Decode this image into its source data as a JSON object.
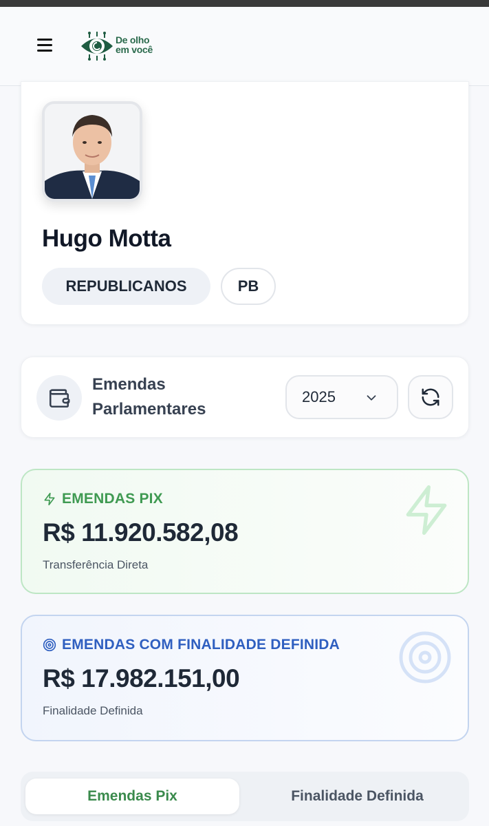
{
  "header": {
    "logo_line1": "De olho",
    "logo_line2": "em você"
  },
  "profile": {
    "name": "Hugo Motta",
    "party": "REPUBLICANOS",
    "state": "PB"
  },
  "emendas": {
    "title_line1": "Emendas",
    "title_line2": "Parlamentares",
    "year": "2025"
  },
  "stats": {
    "pix": {
      "label": "EMENDAS PIX",
      "value": "R$ 11.920.582,08",
      "sub": "Transferência Direta"
    },
    "finalidade": {
      "label": "EMENDAS COM FINALIDADE DEFINIDA",
      "value": "R$ 17.982.151,00",
      "sub": "Finalidade Definida"
    }
  },
  "tabs": {
    "active": "Emendas Pix",
    "inactive": "Finalidade Definida"
  },
  "colors": {
    "brand_green": "#2a6a4c",
    "pix_green": "#3f9a52",
    "fin_blue": "#2f5fc0"
  }
}
